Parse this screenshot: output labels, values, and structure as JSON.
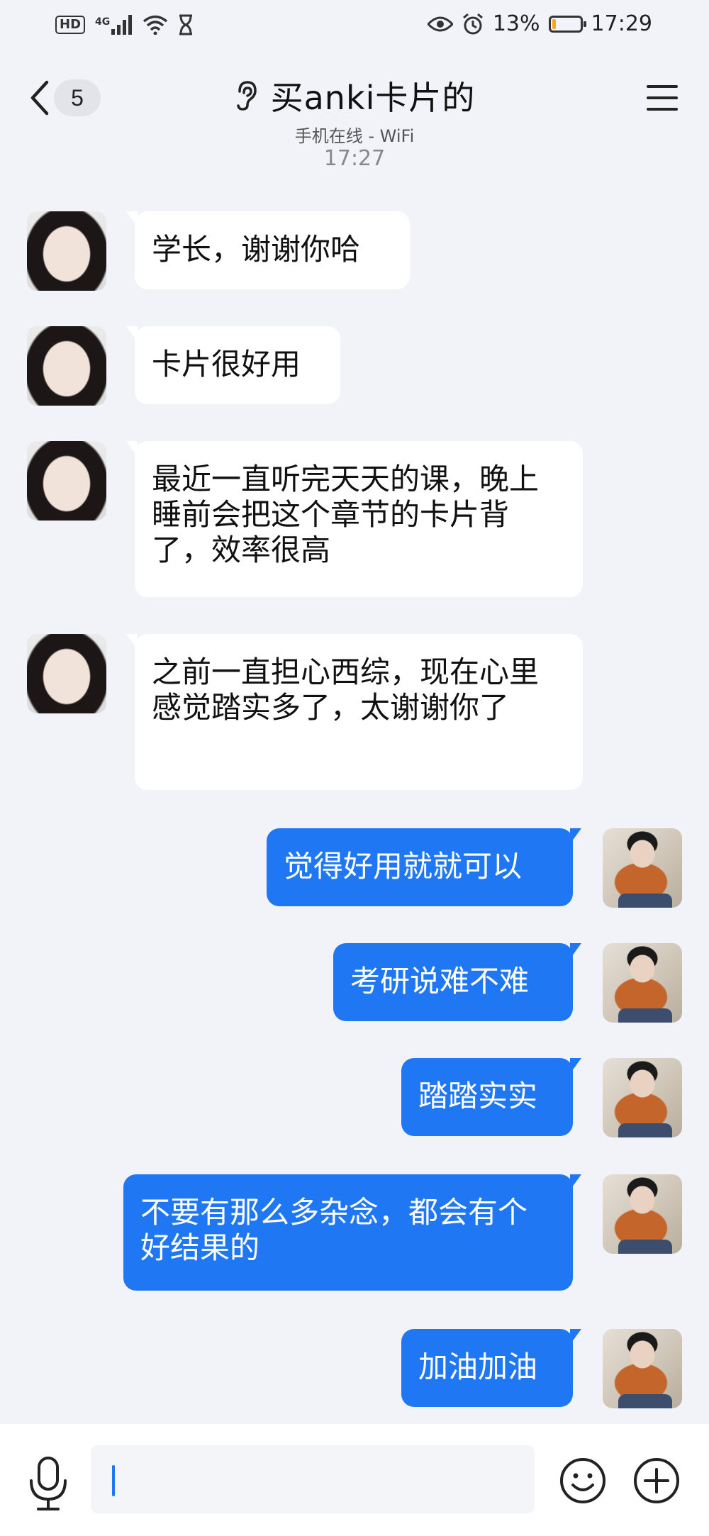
{
  "status_bar": {
    "hd": "HD",
    "network": "4G",
    "battery_percent": "13%",
    "battery_level": 0.13,
    "time": "17:29"
  },
  "header": {
    "unread_count": "5",
    "title": "买anki卡片的",
    "subtitle": "手机在线 - WiFi"
  },
  "chat": {
    "timestamp": "17:27",
    "messages": [
      {
        "direction": "incoming",
        "text": "学长，谢谢你哈"
      },
      {
        "direction": "incoming",
        "text": "卡片很好用"
      },
      {
        "direction": "incoming",
        "text": "最近一直听完天天的课，晚上睡前会把这个章节的卡片背了，效率很高"
      },
      {
        "direction": "incoming",
        "text": "之前一直担心西综，现在心里感觉踏实多了，太谢谢你了"
      },
      {
        "direction": "outgoing",
        "text": "觉得好用就就可以"
      },
      {
        "direction": "outgoing",
        "text": "考研说难不难"
      },
      {
        "direction": "outgoing",
        "text": "踏踏实实"
      },
      {
        "direction": "outgoing",
        "text": "不要有那么多杂念，都会有个好结果的"
      },
      {
        "direction": "outgoing",
        "text": "加油加油"
      }
    ]
  },
  "input_bar": {
    "value": "",
    "placeholder": ""
  },
  "colors": {
    "background": "#f2f3f8",
    "outgoing_bubble": "#1f77f3",
    "incoming_bubble": "#ffffff",
    "battery_low": "#f5a623"
  }
}
